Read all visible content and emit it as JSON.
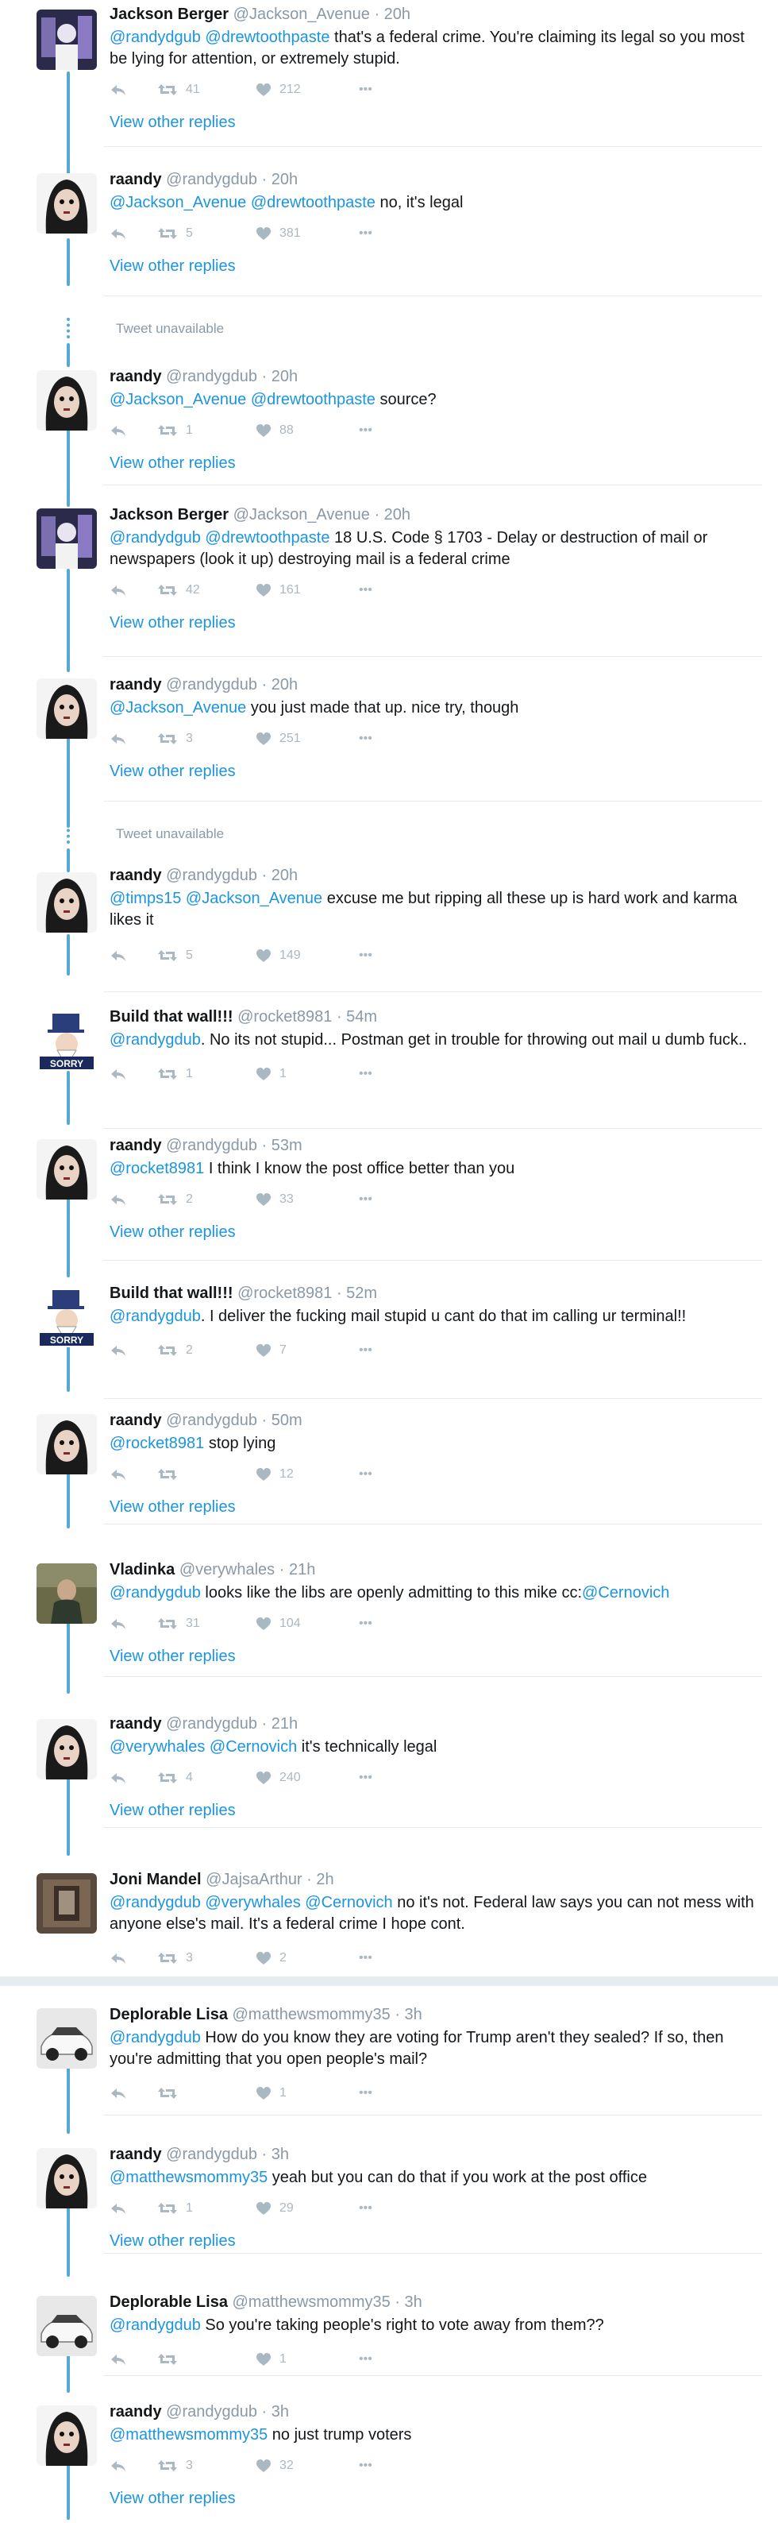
{
  "colors": {
    "thread_line": "#56a9d2",
    "link": "#1b95e0",
    "muted": "#8a99a6",
    "action": "#aab8c2"
  },
  "view_other_replies_label": "View other replies",
  "tweet_unavailable_label": "Tweet unavailable",
  "tweets": [
    {
      "name": "Jackson Berger",
      "handle": "@Jackson_Avenue",
      "time": "· 20h",
      "text_main": "@randydgub @drewtoothpaste that's a federal crime. You're claiming its legal so you most be lying for attention, or extremely stupid.",
      "retweets": "41",
      "likes": "212",
      "view_replies": "View other replies"
    },
    {
      "name": "raandy",
      "handle": "@randygdub",
      "time": "· 20h",
      "text_main": "@Jackson_Avenue @drewtoothpaste no, it's legal",
      "retweets": "5",
      "likes": "381",
      "view_replies": "View other replies"
    },
    {
      "name": "raandy",
      "handle": "@randygdub",
      "time": "· 20h",
      "text_main": "@Jackson_Avenue @drewtoothpaste source?",
      "retweets": "1",
      "likes": "88",
      "view_replies": "View other replies"
    },
    {
      "name": "Jackson Berger",
      "handle": "@Jackson_Avenue",
      "time": "· 20h",
      "text_main": "@randydgub @drewtoothpaste 18 U.S. Code § 1703 - Delay or destruction of mail or newspapers (look it up) destroying mail is a federal crime",
      "retweets": "42",
      "likes": "161",
      "view_replies": "View other replies"
    },
    {
      "name": "raandy",
      "handle": "@randygdub",
      "time": "· 20h",
      "text_main": "@Jackson_Avenue you just made that up. nice try, though",
      "retweets": "3",
      "likes": "251",
      "view_replies": "View other replies"
    },
    {
      "name": "raandy",
      "handle": "@randygdub",
      "time": "· 20h",
      "text_main": "@timps15 @Jackson_Avenue excuse me but ripping all these up is hard work and karma likes it",
      "retweets": "5",
      "likes": "149"
    },
    {
      "name": "Build that wall!!!",
      "handle": "@rocket8981",
      "time": "· 54m",
      "text_main": "@randygdub. No its not stupid... Postman get in trouble for throwing out mail u dumb fuck..",
      "retweets": "1",
      "likes": "1"
    },
    {
      "name": "raandy",
      "handle": "@randygdub",
      "time": "· 53m",
      "text_main": "@rocket8981 I think I know the post office better than you",
      "retweets": "2",
      "likes": "33",
      "view_replies": "View other replies"
    },
    {
      "name": "Build that wall!!!",
      "handle": "@rocket8981",
      "time": "· 52m",
      "text_main": "@randygdub. I deliver the fucking mail stupid u cant do that im calling ur terminal!!",
      "retweets": "2",
      "likes": "7"
    },
    {
      "name": "raandy",
      "handle": "@randygdub",
      "time": "· 50m",
      "text_main": "@rocket8981 stop lying",
      "retweets": "",
      "likes": "12",
      "view_replies": "View other replies"
    },
    {
      "name": "Vladinka",
      "handle": "@verywhales",
      "time": "· 21h",
      "text_main": "@randygdub looks like the libs are openly admitting to this mike cc:@Cernovich",
      "retweets": "31",
      "likes": "104",
      "view_replies": "View other replies"
    },
    {
      "name": "raandy",
      "handle": "@randygdub",
      "time": "· 21h",
      "text_main": "@verywhales @Cernovich it's technically legal",
      "retweets": "4",
      "likes": "240",
      "view_replies": "View other replies"
    },
    {
      "name": "Joni Mandel",
      "handle": "@JajsaArthur",
      "time": "· 2h",
      "text_main": "@randygdub @verywhales @Cernovich no it's not. Federal law says you can not mess with anyone else's mail. It's a federal crime I hope cont.",
      "retweets": "3",
      "likes": "2"
    },
    {
      "name": "Deplorable Lisa",
      "handle": "@matthewsmommy35",
      "time": "· 3h",
      "text_main": "@randygdub How do you know they are voting for Trump aren't they sealed? If so, then you're admitting that you open people's mail?",
      "retweets": "",
      "likes": "1"
    },
    {
      "name": "raandy",
      "handle": "@randygdub",
      "time": "· 3h",
      "text_main": "@matthewsmommy35 yeah but you can do that if you work at the post office",
      "retweets": "1",
      "likes": "29",
      "view_replies": "View other replies"
    },
    {
      "name": "Deplorable Lisa",
      "handle": "@matthewsmommy35",
      "time": "· 3h",
      "text_main": "@randygdub So you're taking people's right to vote away from them??",
      "retweets": "",
      "likes": "1"
    },
    {
      "name": "raandy",
      "handle": "@randygdub",
      "time": "· 3h",
      "text_main": "@matthewsmommy35 no just trump voters",
      "retweets": "3",
      "likes": "32",
      "view_replies": "View other replies"
    }
  ]
}
